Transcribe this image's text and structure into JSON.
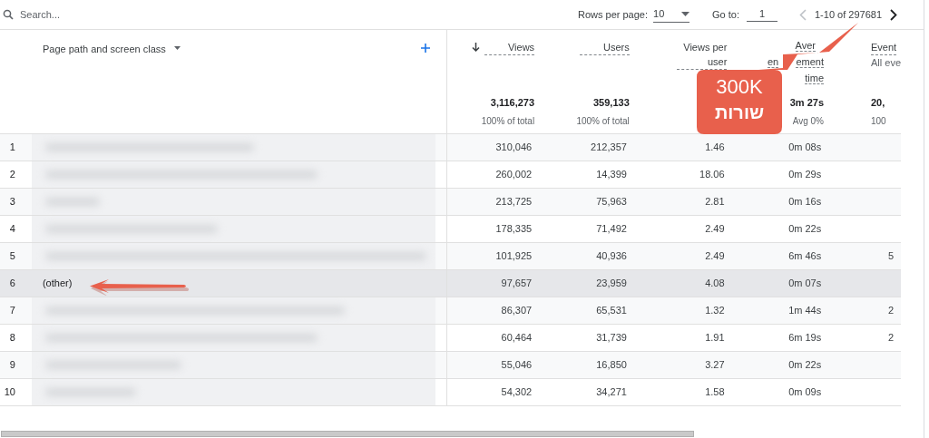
{
  "search": {
    "placeholder": "Search..."
  },
  "pagination": {
    "rows_label": "Rows per page:",
    "rows_value": "10",
    "goto_label": "Go to:",
    "goto_value": "1",
    "range": "1-10 of 297681",
    "prev_disabled": true
  },
  "table": {
    "dimension_header": "Page path and screen class",
    "columns": [
      {
        "label": "Views",
        "sorted": true,
        "total": "3,116,273",
        "total_note": "100% of total"
      },
      {
        "label": "Users",
        "sorted": false,
        "total": "359,133",
        "total_note": "100% of total"
      },
      {
        "label": "Views per user",
        "sorted": false
      },
      {
        "label_lines": [
          [
            "Aver"
          ],
          [
            "en",
            "ement"
          ],
          [
            "time"
          ]
        ],
        "sorted": false,
        "total": "3m 27s",
        "total_note": "Avg 0%"
      },
      {
        "label": "Event",
        "subtitle": "All eve",
        "sorted": false,
        "total": "20,",
        "total_note": "100"
      }
    ],
    "rows": [
      {
        "index": "1",
        "redacted": true,
        "highlighted": false,
        "values": [
          "310,046",
          "212,357",
          "1.46",
          "0m 08s"
        ]
      },
      {
        "index": "2",
        "redacted": true,
        "highlighted": false,
        "values": [
          "260,002",
          "14,399",
          "18.06",
          "0m 29s"
        ]
      },
      {
        "index": "3",
        "redacted": true,
        "highlighted": false,
        "values": [
          "213,725",
          "75,963",
          "2.81",
          "0m 16s"
        ]
      },
      {
        "index": "4",
        "redacted": true,
        "highlighted": false,
        "values": [
          "178,335",
          "71,492",
          "2.49",
          "0m 22s"
        ]
      },
      {
        "index": "5",
        "redacted": true,
        "highlighted": false,
        "values": [
          "101,925",
          "40,936",
          "2.49",
          "6m 46s"
        ],
        "event": "5"
      },
      {
        "index": "6",
        "redacted": false,
        "page_path": "(other)",
        "highlighted": true,
        "values": [
          "97,657",
          "23,959",
          "4.08",
          "0m 07s"
        ]
      },
      {
        "index": "7",
        "redacted": true,
        "highlighted": false,
        "values": [
          "86,307",
          "65,531",
          "1.32",
          "1m 44s"
        ],
        "event": "2"
      },
      {
        "index": "8",
        "redacted": true,
        "highlighted": false,
        "values": [
          "60,464",
          "31,739",
          "1.91",
          "6m 19s"
        ],
        "event": "2"
      },
      {
        "index": "9",
        "redacted": true,
        "highlighted": false,
        "values": [
          "55,046",
          "16,850",
          "3.27",
          "0m 22s"
        ]
      },
      {
        "index": "10",
        "redacted": true,
        "highlighted": false,
        "values": [
          "54,302",
          "34,271",
          "1.58",
          "0m 09s"
        ]
      }
    ]
  },
  "callout": {
    "lines": [
      "300K",
      "שורות"
    ]
  }
}
